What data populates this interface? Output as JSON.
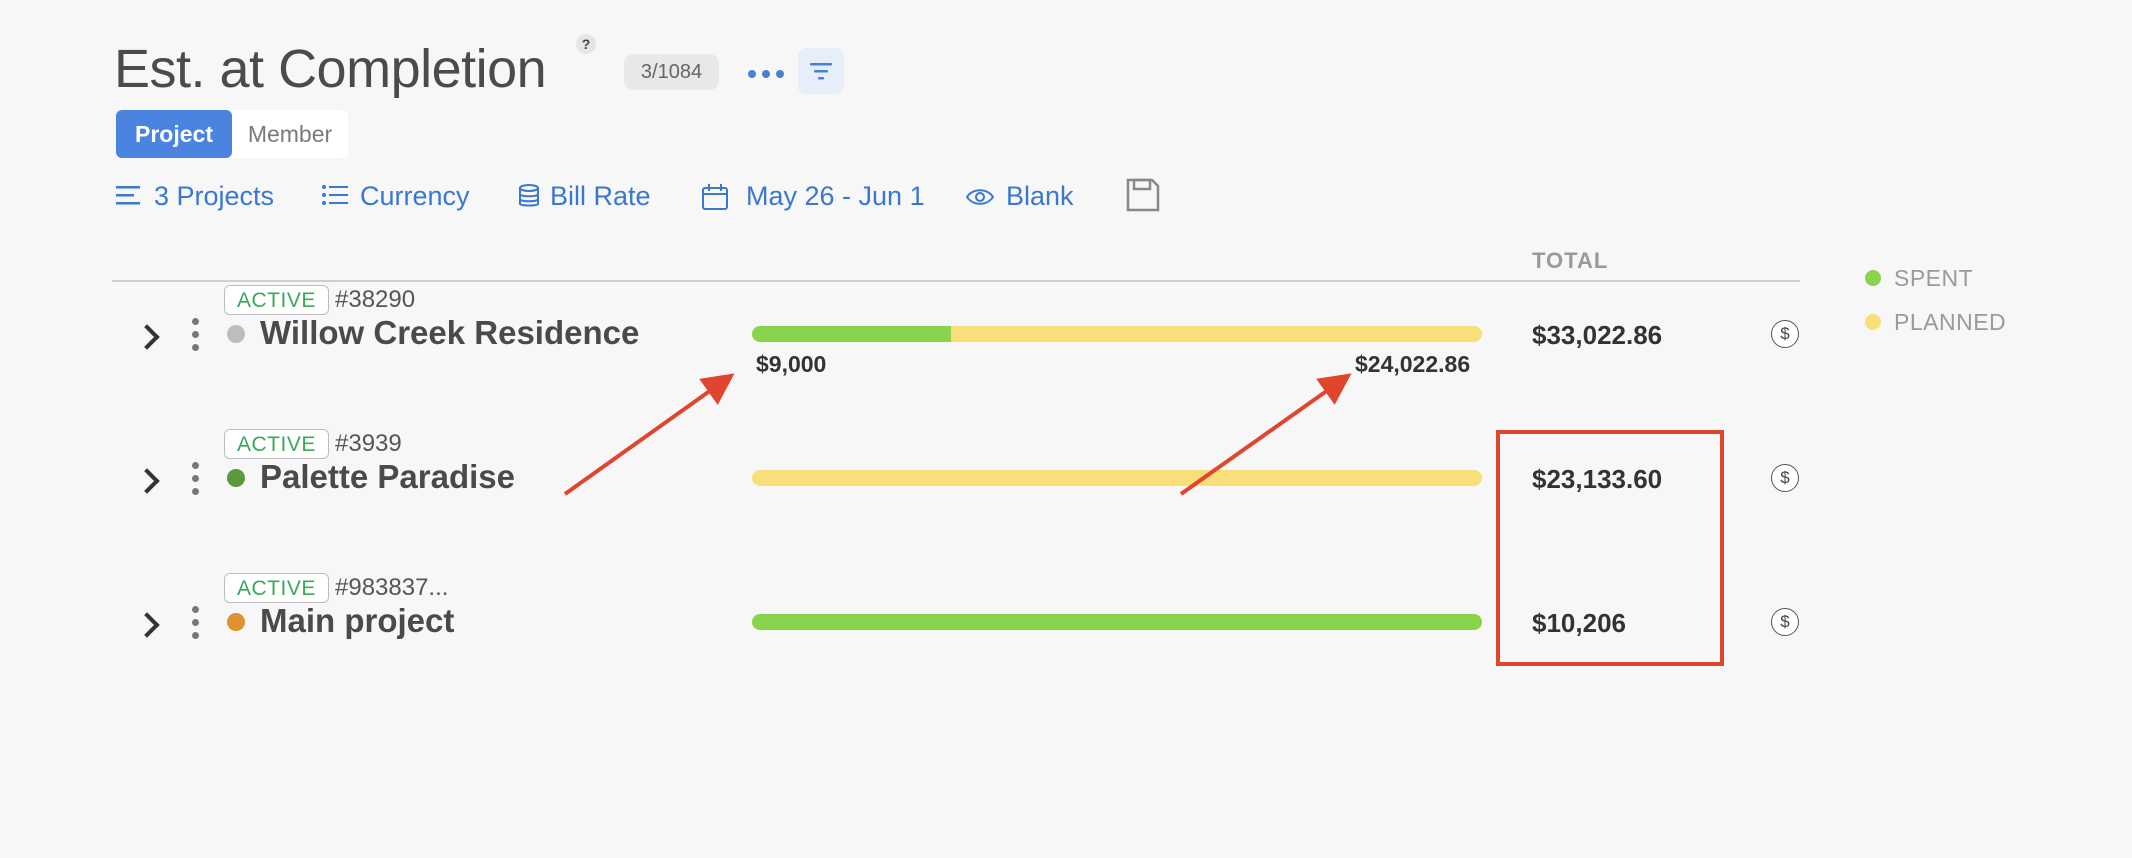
{
  "header": {
    "title": "Est. at Completion",
    "help_label": "?",
    "count": "3/1084"
  },
  "tabs": [
    {
      "label": "Project",
      "active": true
    },
    {
      "label": "Member",
      "active": false
    }
  ],
  "toolbar": {
    "projects_label": "3 Projects",
    "currency_label": "Currency",
    "bill_rate_label": "Bill Rate",
    "date_range_label": "May 26 - Jun 1",
    "blank_label": "Blank"
  },
  "table": {
    "total_header": "TOTAL"
  },
  "legend": [
    {
      "label": "SPENT",
      "color": "#8ad44b"
    },
    {
      "label": "PLANNED",
      "color": "#f8df7a"
    }
  ],
  "rows": [
    {
      "status": "ACTIVE",
      "id": "#38290",
      "name": "Willow Creek Residence",
      "dot_color": "#bdbdbd",
      "spent_label": "$9,000",
      "planned_label": "$24,022.86",
      "spent_fraction": 0.2725,
      "total": "$33,022.86"
    },
    {
      "status": "ACTIVE",
      "id": "#3939",
      "name": "Palette Paradise",
      "dot_color": "#5a9a3a",
      "spent_fraction": 0,
      "total": "$23,133.60"
    },
    {
      "status": "ACTIVE",
      "id": "#983837...",
      "name": "Main project",
      "dot_color": "#e0912f",
      "spent_fraction": 1,
      "total": "$10,206"
    }
  ],
  "colors": {
    "accent": "#4a84e0",
    "link": "#3a78cf",
    "spent": "#8ad44b",
    "planned": "#f8df7a",
    "annotation": "#e0452e",
    "active_text": "#3aa85a"
  }
}
